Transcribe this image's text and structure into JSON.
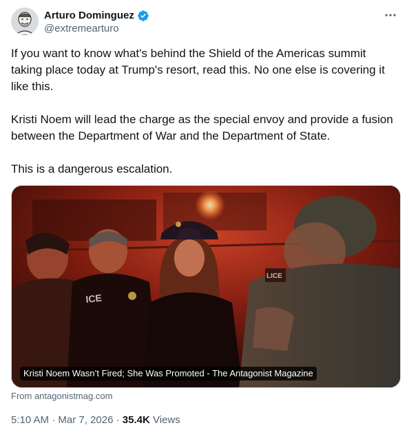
{
  "author": {
    "display_name": "Arturo Dominguez",
    "handle": "@extremearturo",
    "verified": true,
    "verified_color": "#1d9bf0"
  },
  "icons": {
    "avatar": "avatar-illustration",
    "verified": "verified-badge-icon",
    "more": "more-horizontal-icon"
  },
  "tweet": {
    "paragraphs": [
      "If you want to know what's behind the Shield of the Americas summit taking place today at Trump's resort, read this. No one else is covering it like this.",
      "Kristi Noem will lead the charge as the special envoy and provide a fusion between the Department of War and the Department of State.",
      "This is a dangerous escalation."
    ]
  },
  "card": {
    "title": "Kristi Noem Wasn’t Fired; She Was Promoted - The Antagonist Magazine",
    "source": "From antagonistmag.com"
  },
  "footer": {
    "time": "5:10 AM",
    "separator": "·",
    "date": "Mar 7, 2026",
    "views_count": "35.4K",
    "views_label": "Views"
  },
  "colors": {
    "text_primary": "#0f1419",
    "text_secondary": "#536471",
    "card_border": "#cfd9de"
  }
}
